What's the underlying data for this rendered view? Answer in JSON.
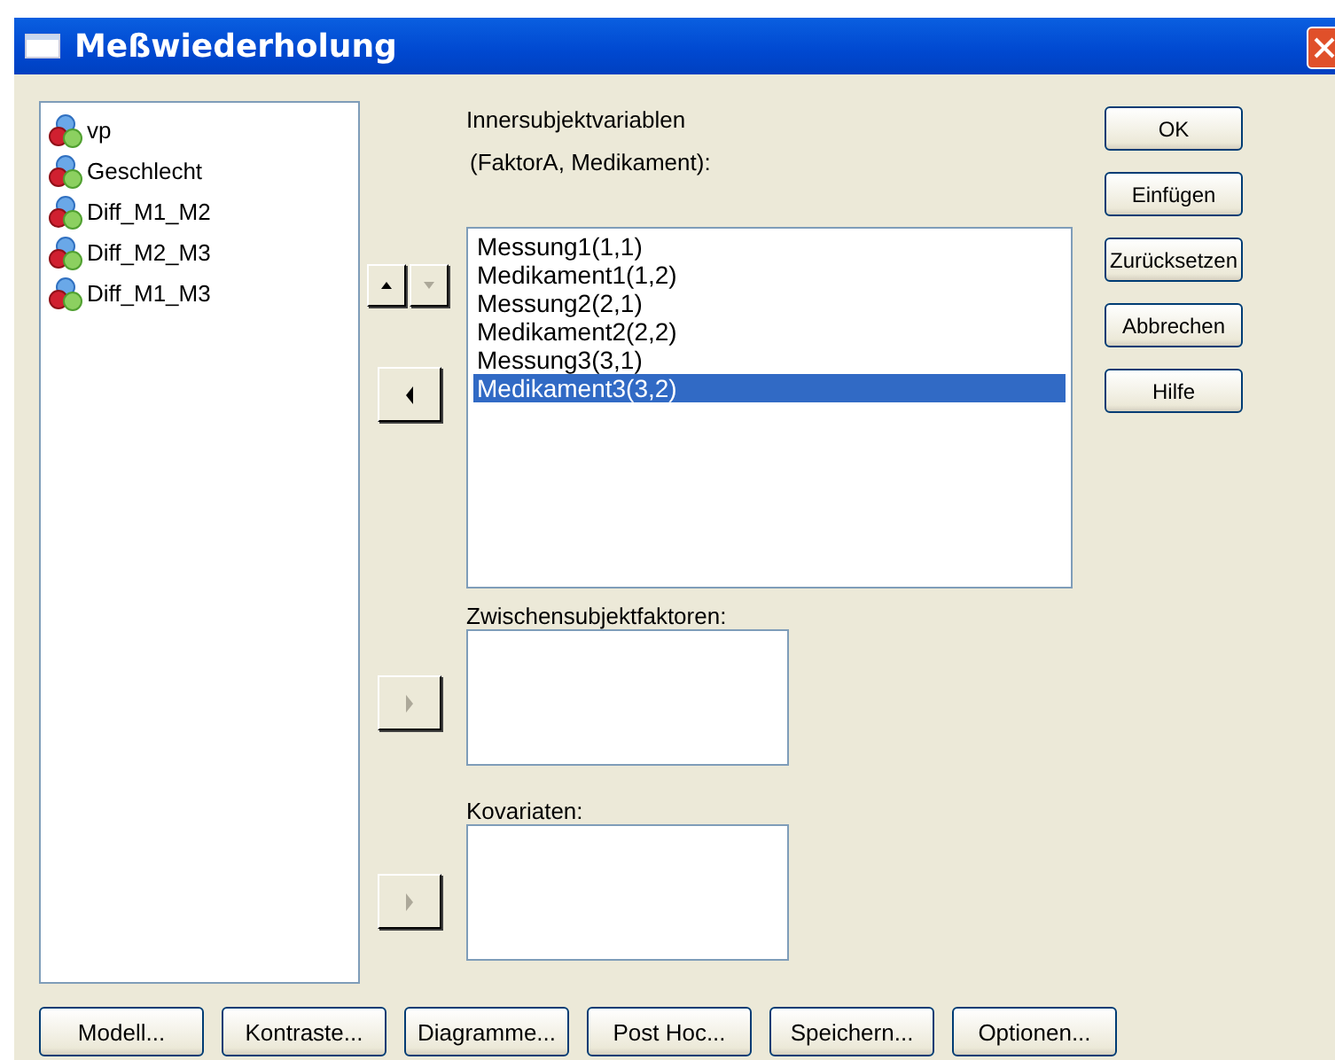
{
  "window": {
    "title": "Meßwiederholung"
  },
  "source_variables": [
    {
      "label": "vp"
    },
    {
      "label": "Geschlecht"
    },
    {
      "label": "Diff_M1_M2"
    },
    {
      "label": "Diff_M2_M3"
    },
    {
      "label": "Diff_M1_M3"
    }
  ],
  "within_subject": {
    "label_lines": [
      "Innersubjektvariablen",
      "(FaktorA, Medikament):"
    ],
    "order_buttons": [
      {
        "kind": "up",
        "disabled": false
      },
      {
        "kind": "down",
        "disabled": true
      }
    ],
    "move_button": {
      "kind": "left",
      "disabled": false
    },
    "items": [
      {
        "label": "Messung1(1,1)",
        "selected": false
      },
      {
        "label": "Medikament1(1,2)",
        "selected": false
      },
      {
        "label": "Messung2(2,1)",
        "selected": false
      },
      {
        "label": "Medikament2(2,2)",
        "selected": false
      },
      {
        "label": "Messung3(3,1)",
        "selected": false
      },
      {
        "label": "Medikament3(3,2)",
        "selected": true
      }
    ]
  },
  "between_subject": {
    "label": "Zwischensubjektfaktoren:",
    "move_button": {
      "kind": "right",
      "disabled": true
    }
  },
  "covariates": {
    "label": "Kovariaten:",
    "move_button": {
      "kind": "right",
      "disabled": true
    }
  },
  "side_buttons": [
    "OK",
    "Einfügen",
    "Zurücksetzen",
    "Abbrechen",
    "Hilfe"
  ],
  "bottom_buttons": [
    "Modell...",
    "Kontraste...",
    "Diagramme...",
    "Post Hoc...",
    "Speichern...",
    "Optionen..."
  ]
}
